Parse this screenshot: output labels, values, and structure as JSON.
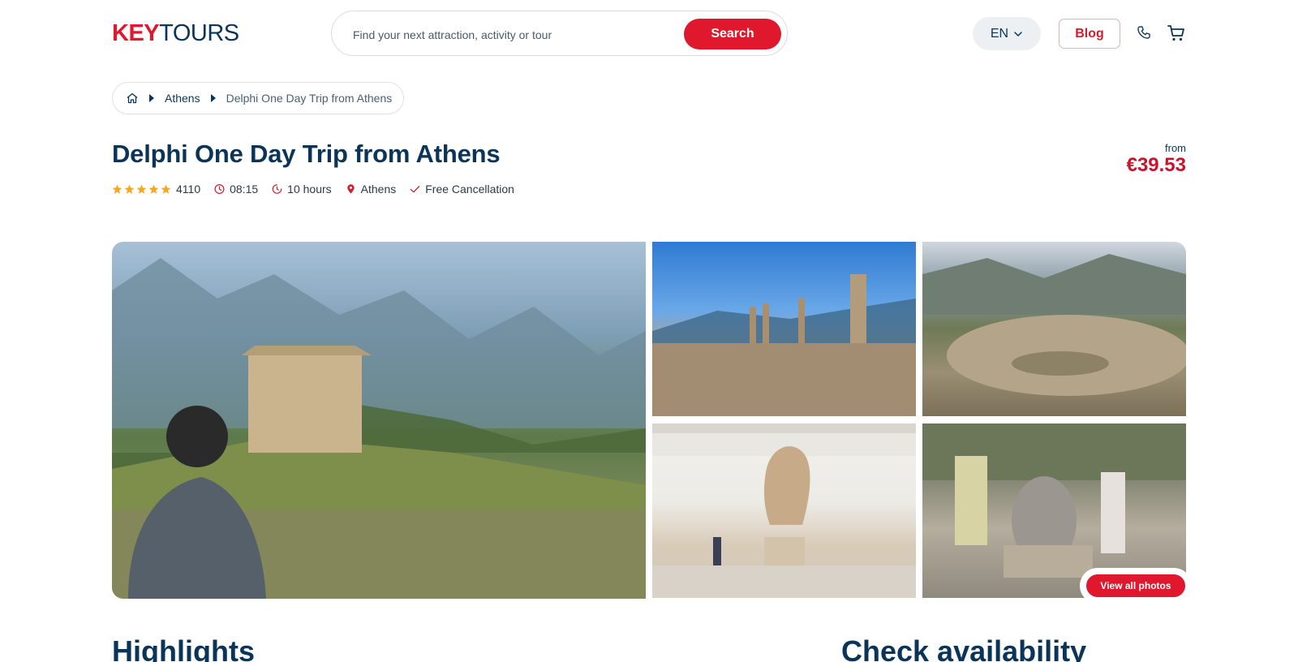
{
  "header": {
    "logo_key": "KEY",
    "logo_tours": "TOURS",
    "search_placeholder": "Find your next attraction, activity or tour",
    "search_button": "Search",
    "language": "EN",
    "blog_label": "Blog"
  },
  "breadcrumb": {
    "items": [
      "Athens",
      "Delphi One Day Trip from Athens"
    ]
  },
  "tour": {
    "title": "Delphi One Day Trip from Athens",
    "rating_count": "4110",
    "start_time": "08:15",
    "duration": "10 hours",
    "location": "Athens",
    "cancellation": "Free Cancellation",
    "price_prefix": "from",
    "price": "€39.53",
    "stars": 5
  },
  "gallery": {
    "view_all_label": "View all photos"
  },
  "sections": {
    "highlights": "Highlights",
    "check_availability": "Check availability"
  },
  "colors": {
    "brand_red": "#e0182d",
    "navy": "#0b3558",
    "star": "#f5a623"
  }
}
